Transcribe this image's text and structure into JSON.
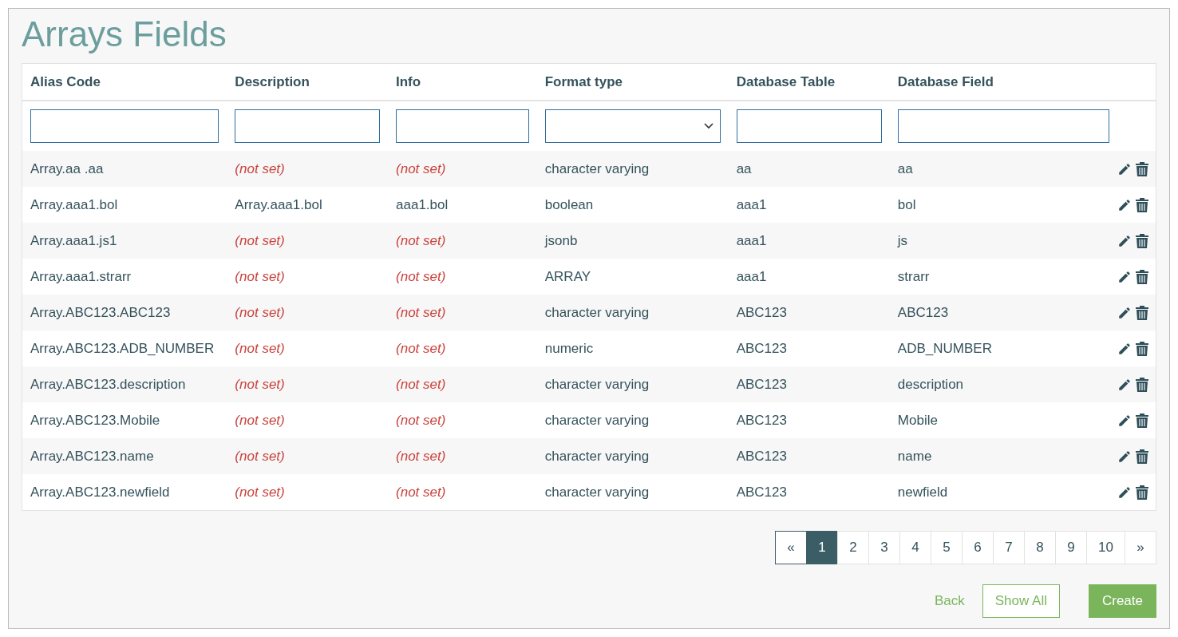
{
  "title": "Arrays Fields",
  "columns": [
    "Alias Code",
    "Description",
    "Info",
    "Format type",
    "Database Table",
    "Database Field"
  ],
  "filters": [
    {
      "kind": "text"
    },
    {
      "kind": "text"
    },
    {
      "kind": "text"
    },
    {
      "kind": "select"
    },
    {
      "kind": "text"
    },
    {
      "kind": "text"
    }
  ],
  "rows": [
    {
      "alias": "Array.aa .aa",
      "description": {
        "text": "(not set)",
        "kind": "unset"
      },
      "info": {
        "text": "(not set)",
        "kind": "unset"
      },
      "format": "character varying",
      "table": "aa",
      "field": "aa"
    },
    {
      "alias": "Array.aaa1.bol",
      "description": {
        "text": "Array.aaa1.bol",
        "kind": "value"
      },
      "info": {
        "text": "aaa1.bol",
        "kind": "value"
      },
      "format": "boolean",
      "table": "aaa1",
      "field": "bol"
    },
    {
      "alias": "Array.aaa1.js1",
      "description": {
        "text": "(not set)",
        "kind": "unset"
      },
      "info": {
        "text": "(not set)",
        "kind": "unset"
      },
      "format": "jsonb",
      "table": "aaa1",
      "field": "js"
    },
    {
      "alias": "Array.aaa1.strarr",
      "description": {
        "text": "(not set)",
        "kind": "unset"
      },
      "info": {
        "text": "(not set)",
        "kind": "unset"
      },
      "format": "ARRAY",
      "table": "aaa1",
      "field": "strarr"
    },
    {
      "alias": "Array.ABC123.ABC123",
      "description": {
        "text": "(not set)",
        "kind": "unset"
      },
      "info": {
        "text": "(not set)",
        "kind": "unset"
      },
      "format": "character varying",
      "table": "ABC123",
      "field": "ABC123"
    },
    {
      "alias": "Array.ABC123.ADB_NUMBER",
      "description": {
        "text": "(not set)",
        "kind": "unset"
      },
      "info": {
        "text": "(not set)",
        "kind": "unset"
      },
      "format": "numeric",
      "table": "ABC123",
      "field": "ADB_NUMBER"
    },
    {
      "alias": "Array.ABC123.description",
      "description": {
        "text": "(not set)",
        "kind": "unset"
      },
      "info": {
        "text": "(not set)",
        "kind": "unset"
      },
      "format": "character varying",
      "table": "ABC123",
      "field": "description"
    },
    {
      "alias": "Array.ABC123.Mobile",
      "description": {
        "text": "(not set)",
        "kind": "unset"
      },
      "info": {
        "text": "(not set)",
        "kind": "unset"
      },
      "format": "character varying",
      "table": "ABC123",
      "field": "Mobile"
    },
    {
      "alias": "Array.ABC123.name",
      "description": {
        "text": "(not set)",
        "kind": "unset"
      },
      "info": {
        "text": "(not set)",
        "kind": "unset"
      },
      "format": "character varying",
      "table": "ABC123",
      "field": "name"
    },
    {
      "alias": "Array.ABC123.newfield",
      "description": {
        "text": "(not set)",
        "kind": "unset"
      },
      "info": {
        "text": "(not set)",
        "kind": "unset"
      },
      "format": "character varying",
      "table": "ABC123",
      "field": "newfield"
    }
  ],
  "pagination": [
    {
      "label": "«",
      "selected": false
    },
    {
      "label": "1",
      "selected": true
    },
    {
      "label": "2",
      "selected": false
    },
    {
      "label": "3",
      "selected": false
    },
    {
      "label": "4",
      "selected": false
    },
    {
      "label": "5",
      "selected": false
    },
    {
      "label": "6",
      "selected": false
    },
    {
      "label": "7",
      "selected": false
    },
    {
      "label": "8",
      "selected": false
    },
    {
      "label": "9",
      "selected": false
    },
    {
      "label": "10",
      "selected": false
    },
    {
      "label": "»",
      "selected": false
    }
  ],
  "buttons": [
    {
      "label": "Back",
      "kind": "link"
    },
    {
      "label": "Show All",
      "kind": "outline"
    },
    {
      "label": "Create",
      "kind": "primary"
    }
  ]
}
